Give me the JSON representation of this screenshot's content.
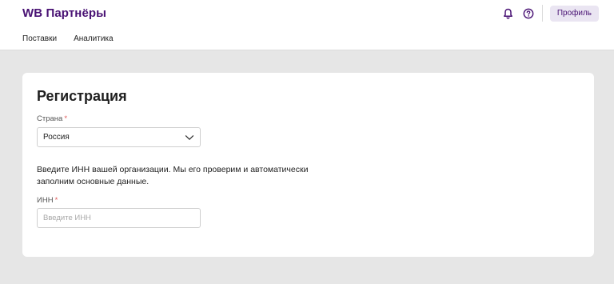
{
  "header": {
    "brand": "WB Партнёры",
    "nav": [
      "Поставки",
      "Аналитика"
    ],
    "actions": {
      "bell_icon": "bell-icon",
      "help_icon": "question-circle-icon",
      "profile_label": "Профиль"
    }
  },
  "form": {
    "title": "Регистрация",
    "country": {
      "label": "Страна",
      "required_mark": "*",
      "value": "Россия",
      "icon": "chevron-down-icon"
    },
    "description": "Введите ИНН вашей организации. Мы его проверим и автоматически заполним основные данные.",
    "inn": {
      "label": "ИНН",
      "required_mark": "*",
      "value": "",
      "placeholder": "Введите ИНН"
    }
  },
  "colors": {
    "brand": "#481173",
    "page_bg": "#e6e6e6",
    "profile_bg": "#eae5f2",
    "required": "#e05a5a"
  }
}
